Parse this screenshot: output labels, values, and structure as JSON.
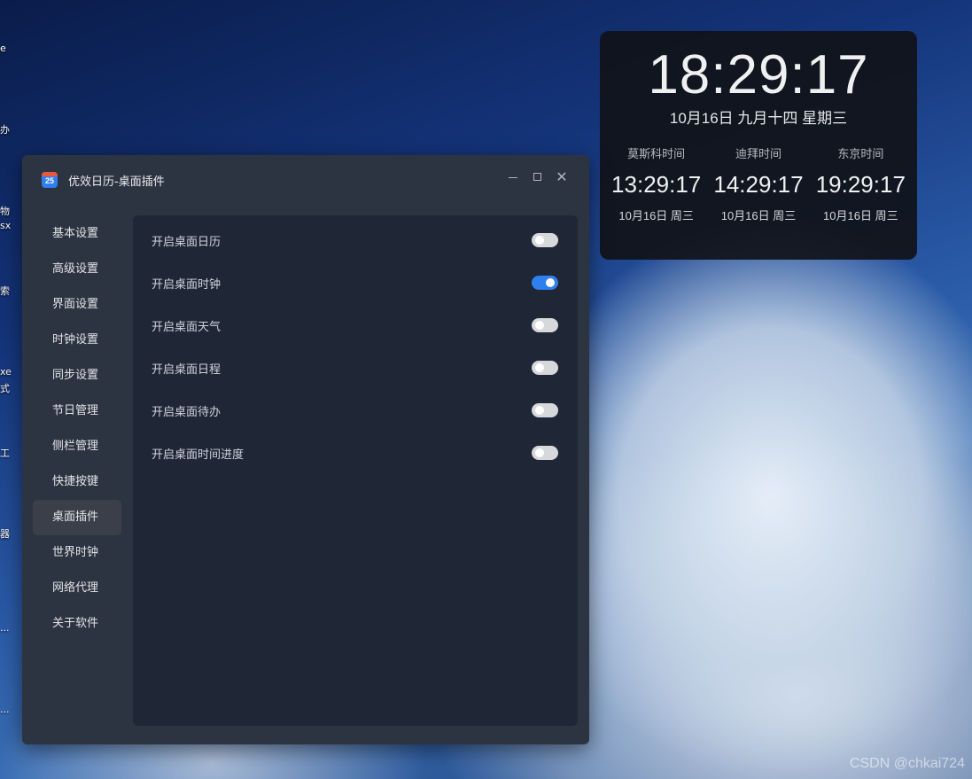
{
  "clock_widget": {
    "time": "18:29:17",
    "date": "10月16日 九月十四 星期三",
    "zones": [
      {
        "name": "莫斯科时间",
        "time": "13:29:17",
        "date": "10月16日 周三"
      },
      {
        "name": "迪拜时间",
        "time": "14:29:17",
        "date": "10月16日 周三"
      },
      {
        "name": "东京时间",
        "time": "19:29:17",
        "date": "10月16日 周三"
      }
    ]
  },
  "window": {
    "icon_text": "25",
    "title": "优效日历-桌面插件",
    "controls": {
      "minimize": "minimize",
      "maximize": "maximize",
      "close": "✕"
    }
  },
  "sidebar": {
    "active": "桌面插件",
    "items": [
      "基本设置",
      "高级设置",
      "界面设置",
      "时钟设置",
      "同步设置",
      "节日管理",
      "侧栏管理",
      "快捷按键",
      "桌面插件",
      "世界时钟",
      "网络代理",
      "关于软件"
    ]
  },
  "settings": [
    {
      "label": "开启桌面日历",
      "enabled": false
    },
    {
      "label": "开启桌面时钟",
      "enabled": true
    },
    {
      "label": "开启桌面天气",
      "enabled": false
    },
    {
      "label": "开启桌面日程",
      "enabled": false
    },
    {
      "label": "开启桌面待办",
      "enabled": false
    },
    {
      "label": "开启桌面时间进度",
      "enabled": false
    }
  ],
  "desktop_icon_fragments": [
    "e",
    "办",
    "物",
    "sx",
    "索",
    "xe",
    "式",
    "工",
    "器",
    "...",
    "..."
  ],
  "watermark": "CSDN @chkai724",
  "colors": {
    "accent": "#2f80ed",
    "window_bg": "#2d3441",
    "content_bg": "#1f2636"
  }
}
